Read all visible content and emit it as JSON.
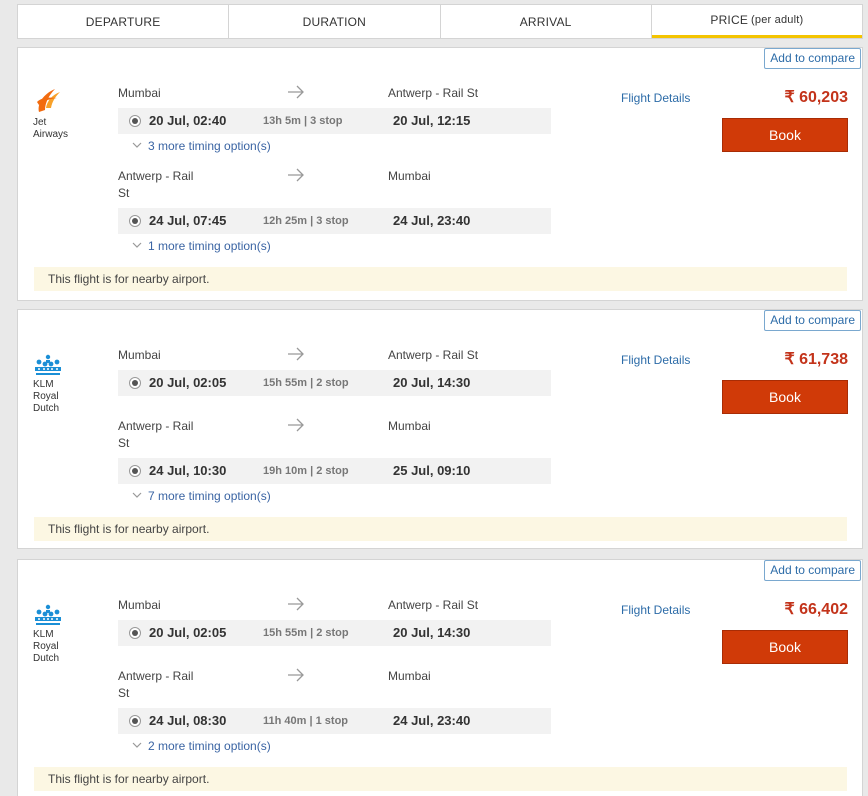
{
  "sortbar": {
    "tabs": [
      {
        "label": "DEPARTURE",
        "sub": ""
      },
      {
        "label": "DURATION",
        "sub": ""
      },
      {
        "label": "ARRIVAL",
        "sub": ""
      },
      {
        "label": "PRICE",
        "sub": "(per adult)"
      }
    ],
    "active_index": 3,
    "active_color": "#f4c400"
  },
  "colors": {
    "price": "#c3331a",
    "book_button": "#d03a08",
    "link": "#2d6ca8",
    "nearby_bg": "#fcf7e3"
  },
  "results": [
    {
      "compare_label": "Add to compare",
      "airline": {
        "name_line1": "Jet",
        "name_line2": "Airways",
        "name_line3": "",
        "logo": "jet-airways-logo"
      },
      "outbound": {
        "from": "Mumbai",
        "to": "Antwerp - Rail St",
        "dep": "20 Jul, 02:40",
        "duration": "13h 5m | 3 stop",
        "arr": "20 Jul, 12:15",
        "more": "3 more timing option(s)"
      },
      "inbound": {
        "from": "Antwerp - Rail St",
        "to": "Mumbai",
        "dep": "24 Jul, 07:45",
        "duration": "12h 25m | 3 stop",
        "arr": "24 Jul, 23:40",
        "more": "1 more timing option(s)"
      },
      "details_label": "Flight Details",
      "price": "₹ 60,203",
      "book_label": "Book",
      "notice": "This flight is for nearby airport."
    },
    {
      "compare_label": "Add to compare",
      "airline": {
        "name_line1": "KLM",
        "name_line2": "Royal",
        "name_line3": "Dutch",
        "logo": "klm-crown-logo"
      },
      "outbound": {
        "from": "Mumbai",
        "to": "Antwerp - Rail St",
        "dep": "20 Jul, 02:05",
        "duration": "15h 55m | 2 stop",
        "arr": "20 Jul, 14:30",
        "more": ""
      },
      "inbound": {
        "from": "Antwerp - Rail St",
        "to": "Mumbai",
        "dep": "24 Jul, 10:30",
        "duration": "19h 10m | 2 stop",
        "arr": "25 Jul, 09:10",
        "more": "7 more timing option(s)"
      },
      "details_label": "Flight Details",
      "price": "₹ 61,738",
      "book_label": "Book",
      "notice": "This flight is for nearby airport."
    },
    {
      "compare_label": "Add to compare",
      "airline": {
        "name_line1": "KLM",
        "name_line2": "Royal",
        "name_line3": "Dutch",
        "logo": "klm-crown-logo"
      },
      "outbound": {
        "from": "Mumbai",
        "to": "Antwerp - Rail St",
        "dep": "20 Jul, 02:05",
        "duration": "15h 55m | 2 stop",
        "arr": "20 Jul, 14:30",
        "more": ""
      },
      "inbound": {
        "from": "Antwerp - Rail St",
        "to": "Mumbai",
        "dep": "24 Jul, 08:30",
        "duration": "11h 40m | 1 stop",
        "arr": "24 Jul, 23:40",
        "more": "2 more timing option(s)"
      },
      "details_label": "Flight Details",
      "price": "₹ 66,402",
      "book_label": "Book",
      "notice": "This flight is for nearby airport."
    }
  ]
}
